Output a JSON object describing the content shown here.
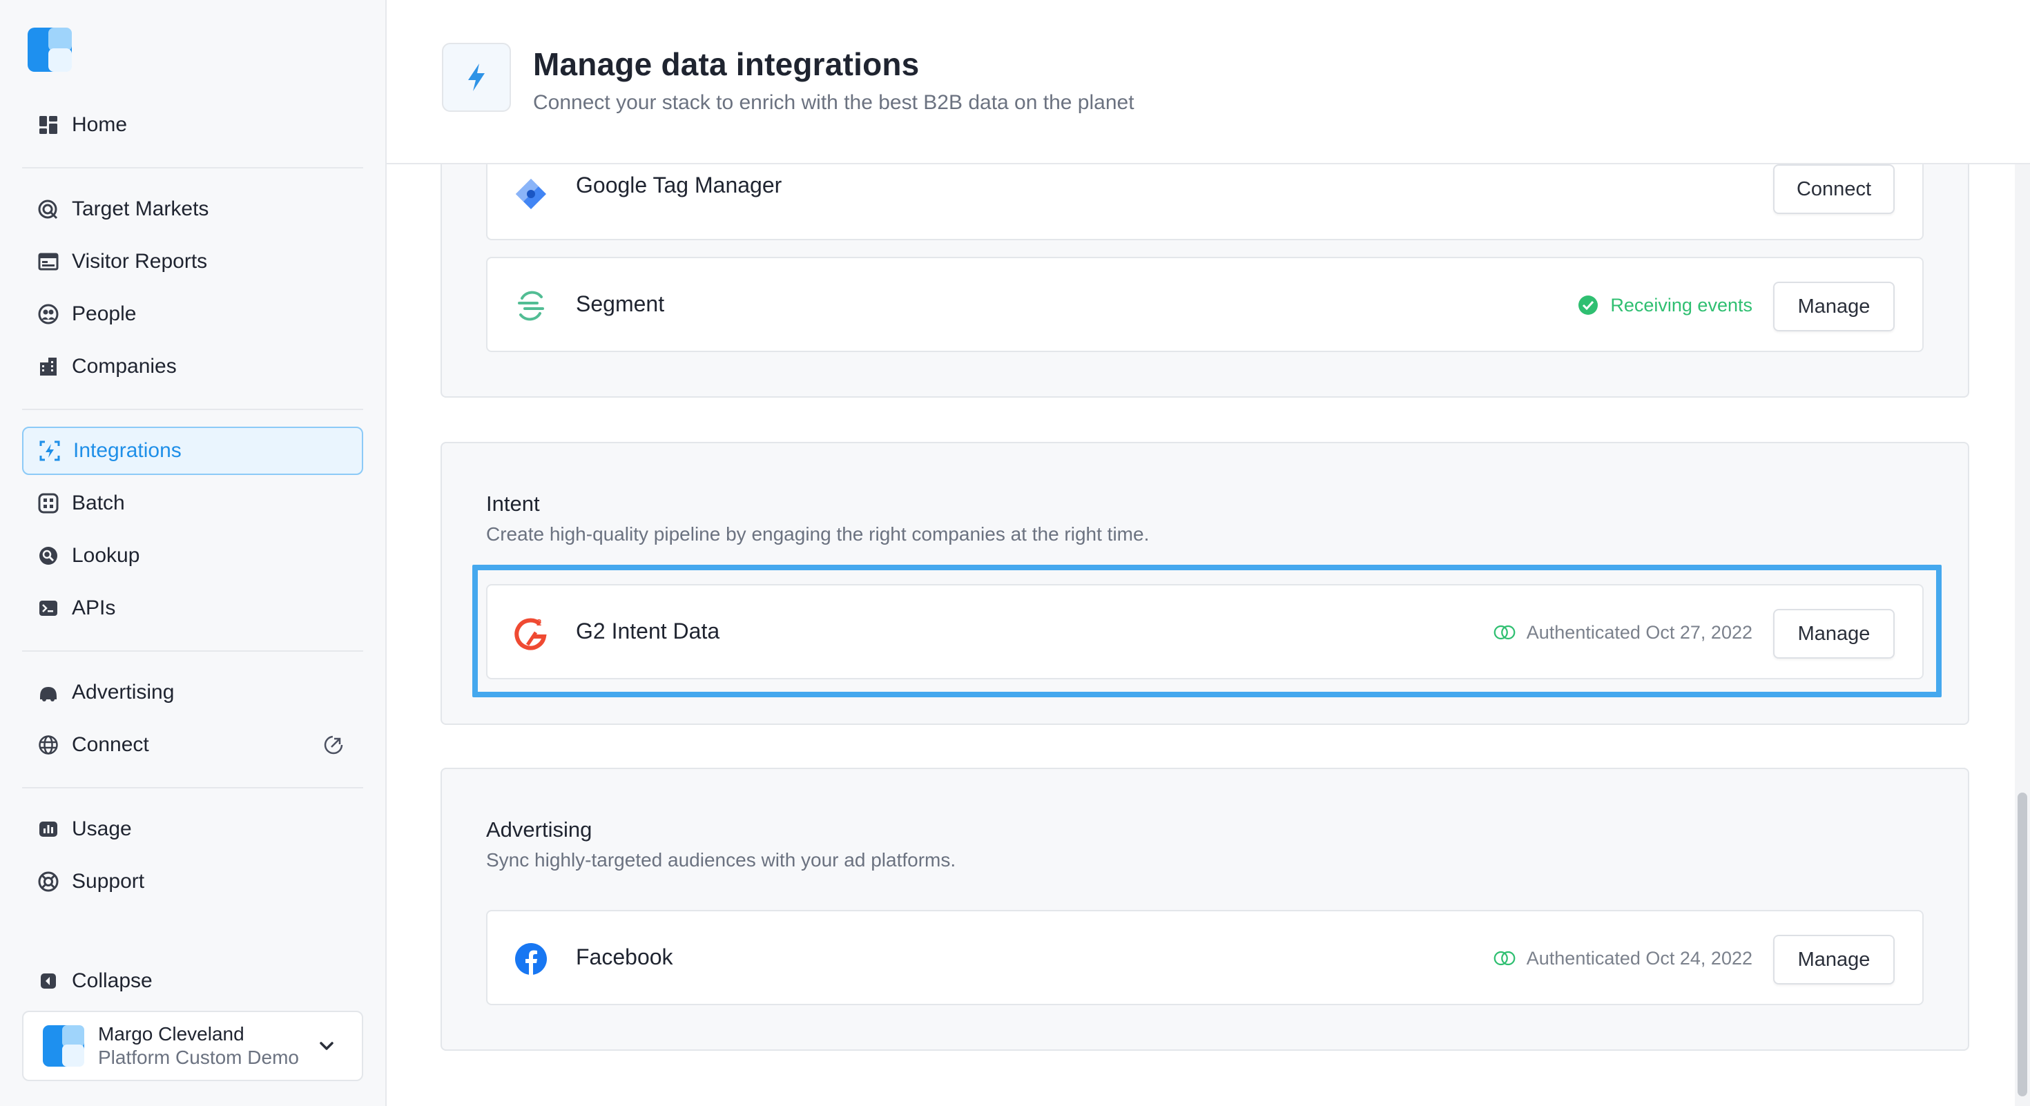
{
  "sidebar": {
    "items": [
      {
        "label": "Home",
        "icon": "home-icon"
      },
      {
        "label": "Target Markets",
        "icon": "target-icon"
      },
      {
        "label": "Visitor Reports",
        "icon": "report-icon"
      },
      {
        "label": "People",
        "icon": "people-icon"
      },
      {
        "label": "Companies",
        "icon": "building-icon"
      },
      {
        "label": "Integrations",
        "icon": "integrations-icon",
        "active": true
      },
      {
        "label": "Batch",
        "icon": "batch-icon"
      },
      {
        "label": "Lookup",
        "icon": "lookup-icon"
      },
      {
        "label": "APIs",
        "icon": "terminal-icon"
      },
      {
        "label": "Advertising",
        "icon": "advertising-icon"
      },
      {
        "label": "Connect",
        "icon": "globe-icon"
      },
      {
        "label": "Usage",
        "icon": "usage-icon"
      },
      {
        "label": "Support",
        "icon": "support-icon"
      },
      {
        "label": "Collapse",
        "icon": "collapse-icon"
      }
    ],
    "account": {
      "name": "Margo Cleveland",
      "org": "Platform Custom Demo"
    }
  },
  "header": {
    "title": "Manage data integrations",
    "subtitle": "Connect your stack to enrich with the best B2B data on the planet"
  },
  "sections": {
    "top": {
      "cards": [
        {
          "name": "Google Tag Manager",
          "button": "Connect"
        },
        {
          "name": "Segment",
          "status": "Receiving events",
          "button": "Manage"
        }
      ]
    },
    "intent": {
      "title": "Intent",
      "description": "Create high-quality pipeline by engaging the right companies at the right time.",
      "cards": [
        {
          "name": "G2 Intent Data",
          "status": "Authenticated Oct 27, 2022",
          "button": "Manage"
        }
      ]
    },
    "advertising": {
      "title": "Advertising",
      "description": "Sync highly-targeted audiences with your ad platforms.",
      "cards": [
        {
          "name": "Facebook",
          "status": "Authenticated Oct 24, 2022",
          "button": "Manage"
        }
      ]
    }
  },
  "colors": {
    "accent": "#1f8fe8",
    "success": "#2fbf71",
    "highlight": "#45a8ee"
  }
}
